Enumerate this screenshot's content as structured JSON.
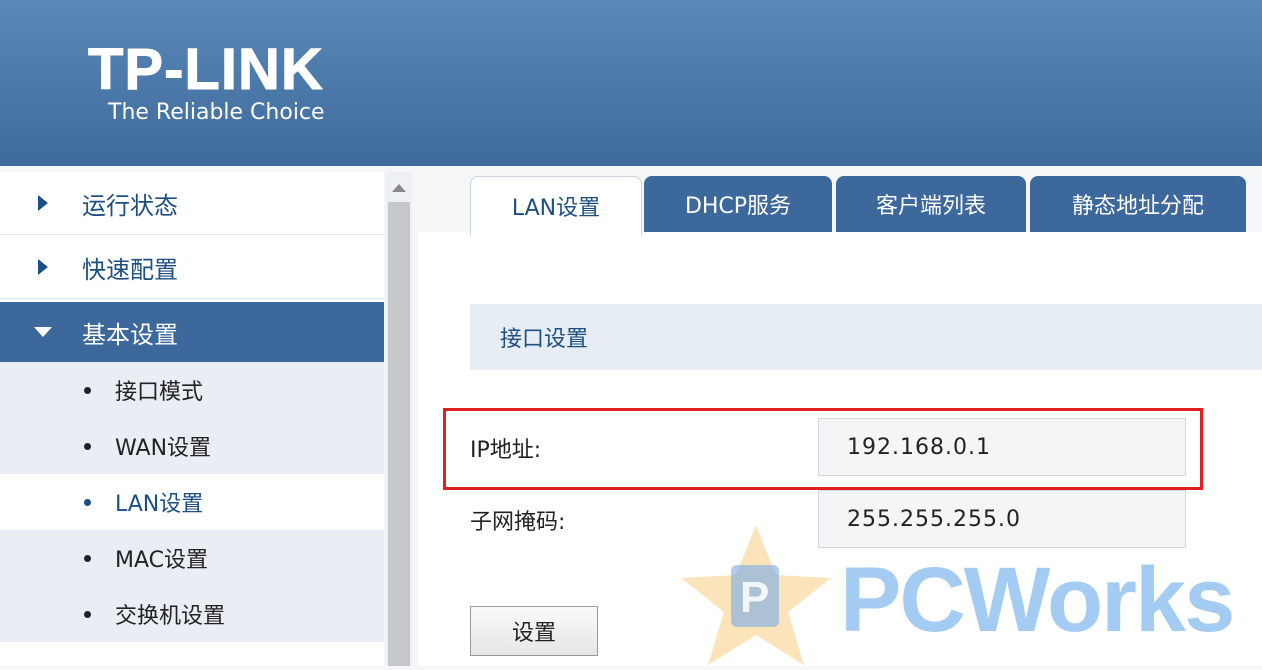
{
  "header": {
    "brand": "TP-LINK",
    "tagline": "The Reliable Choice"
  },
  "sidebar": {
    "items": [
      {
        "label": "运行状态",
        "state": "collapsed"
      },
      {
        "label": "快速配置",
        "state": "collapsed"
      },
      {
        "label": "基本设置",
        "state": "expanded"
      }
    ],
    "subitems": [
      {
        "label": "接口模式"
      },
      {
        "label": "WAN设置"
      },
      {
        "label": "LAN设置",
        "selected": true
      },
      {
        "label": "MAC设置"
      },
      {
        "label": "交换机设置"
      }
    ]
  },
  "tabs": [
    {
      "label": "LAN设置",
      "active": true
    },
    {
      "label": "DHCP服务"
    },
    {
      "label": "客户端列表"
    },
    {
      "label": "静态地址分配"
    }
  ],
  "section": {
    "title": "接口设置"
  },
  "form": {
    "ip_label": "IP地址:",
    "ip_value": "192.168.0.1",
    "mask_label": "子网掩码:",
    "mask_value": "255.255.255.0",
    "submit_label": "设置"
  },
  "watermark": {
    "text": "PCWorks"
  },
  "colors": {
    "header": "#4a78a8",
    "accent": "#3c689b",
    "highlight": "#e02020"
  }
}
